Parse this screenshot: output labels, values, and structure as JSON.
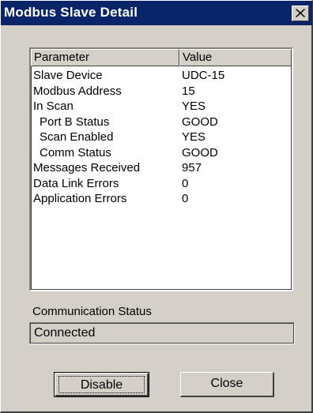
{
  "window": {
    "title": "Modbus Slave Detail"
  },
  "list": {
    "columns": [
      "Parameter",
      "Value"
    ],
    "rows": [
      {
        "parameter": "Slave Device",
        "value": "UDC-15"
      },
      {
        "parameter": "Modbus Address",
        "value": "15"
      },
      {
        "parameter": "In Scan",
        "value": "YES"
      },
      {
        "parameter": "Port B Status",
        "value": "GOOD"
      },
      {
        "parameter": "Scan Enabled",
        "value": "YES"
      },
      {
        "parameter": "Comm Status",
        "value": "GOOD"
      },
      {
        "parameter": "Messages Received",
        "value": "957"
      },
      {
        "parameter": "Data Link Errors",
        "value": "0"
      },
      {
        "parameter": "Application Errors",
        "value": "0"
      }
    ]
  },
  "communication": {
    "label": "Communication Status",
    "value": "Connected"
  },
  "buttons": {
    "disable": "Disable",
    "close": "Close"
  },
  "icons": {
    "close": "close-icon"
  }
}
